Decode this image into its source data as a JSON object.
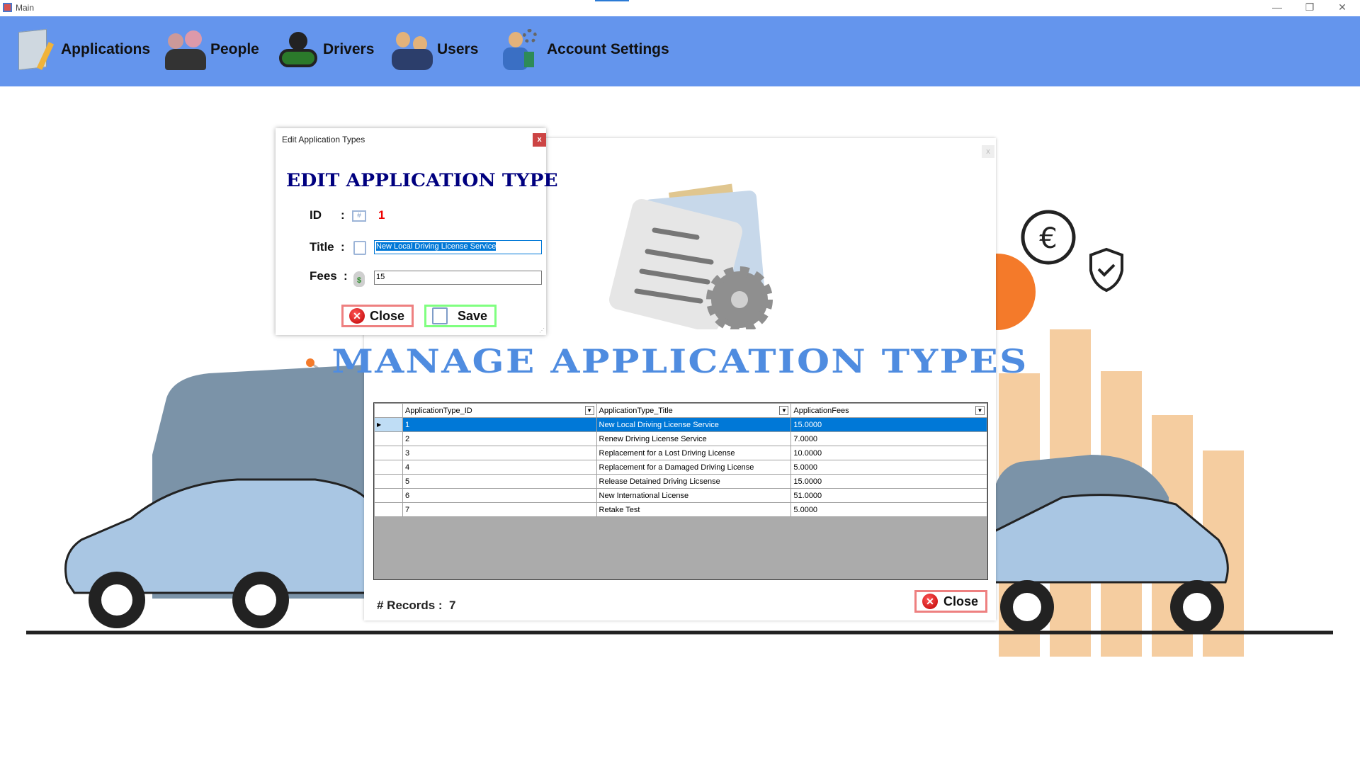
{
  "window": {
    "title": "Main",
    "minimize": "—",
    "restore": "❐",
    "close": "✕"
  },
  "nav": [
    {
      "label": "Applications",
      "icon": "applications-icon"
    },
    {
      "label": "People",
      "icon": "people-icon"
    },
    {
      "label": "Drivers",
      "icon": "drivers-icon"
    },
    {
      "label": "Users",
      "icon": "users-icon"
    },
    {
      "label": "Account Settings",
      "icon": "account-settings-icon"
    }
  ],
  "manage": {
    "title": "MANAGE APPLICATION TYPES",
    "close_x": "x",
    "columns": [
      "ApplicationType_ID",
      "ApplicationType_Title",
      "ApplicationFees"
    ],
    "rows": [
      [
        "1",
        "New Local Driving License Service",
        "15.0000"
      ],
      [
        "2",
        "Renew Driving License Service",
        "7.0000"
      ],
      [
        "3",
        "Replacement for a Lost Driving License",
        "10.0000"
      ],
      [
        "4",
        "Replacement for a Damaged Driving License",
        "5.0000"
      ],
      [
        "5",
        "Release Detained Driving Licsense",
        "15.0000"
      ],
      [
        "6",
        "New International License",
        "51.0000"
      ],
      [
        "7",
        "Retake Test",
        "5.0000"
      ]
    ],
    "records_label": "# Records :",
    "records_count": "7",
    "close_label": "Close"
  },
  "dialog": {
    "caption": "Edit Application Types",
    "close_x": "x",
    "title": "EDIT APPLICATION TYPE",
    "id_label": "ID",
    "colon": ":",
    "id_value": "1",
    "title_label": "Title",
    "title_value": "New Local Driving License Service",
    "fees_label": "Fees",
    "fees_value": "15",
    "close_label": "Close",
    "save_label": "Save"
  },
  "colors": {
    "header": "#6495ED",
    "selected_row": "#0078D7",
    "dialog_title": "#00007F",
    "close_border": "#EE8080",
    "save_border": "#80FF80"
  }
}
